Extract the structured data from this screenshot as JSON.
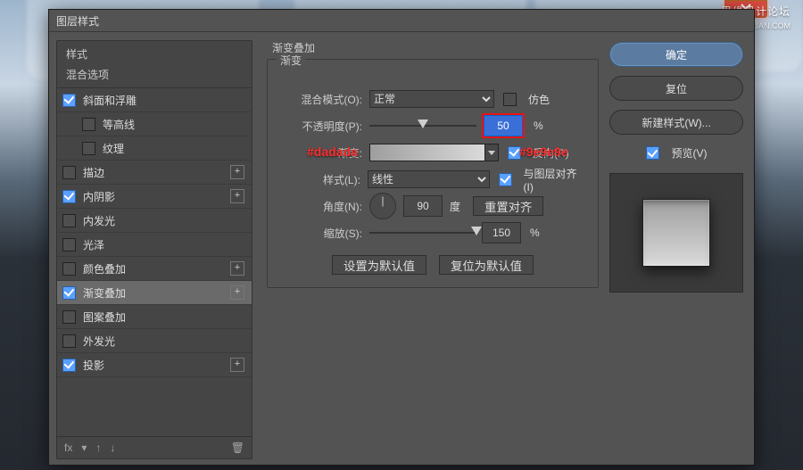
{
  "watermark": {
    "line1": "思缘设计论坛",
    "line2": "WWW.MISSYUAN.COM"
  },
  "dialog": {
    "title": "图层样式"
  },
  "styles_panel": {
    "header": "样式",
    "subheader": "混合选项",
    "items": [
      {
        "label": "斜面和浮雕",
        "checked": true,
        "plus": false,
        "indent": false,
        "selected": false
      },
      {
        "label": "等高线",
        "checked": false,
        "plus": false,
        "indent": true,
        "selected": false
      },
      {
        "label": "纹理",
        "checked": false,
        "plus": false,
        "indent": true,
        "selected": false
      },
      {
        "label": "描边",
        "checked": false,
        "plus": true,
        "indent": false,
        "selected": false
      },
      {
        "label": "内阴影",
        "checked": true,
        "plus": true,
        "indent": false,
        "selected": false
      },
      {
        "label": "内发光",
        "checked": false,
        "plus": false,
        "indent": false,
        "selected": false
      },
      {
        "label": "光泽",
        "checked": false,
        "plus": false,
        "indent": false,
        "selected": false
      },
      {
        "label": "颜色叠加",
        "checked": false,
        "plus": true,
        "indent": false,
        "selected": false
      },
      {
        "label": "渐变叠加",
        "checked": true,
        "plus": true,
        "indent": false,
        "selected": true
      },
      {
        "label": "图案叠加",
        "checked": false,
        "plus": false,
        "indent": false,
        "selected": false
      },
      {
        "label": "外发光",
        "checked": false,
        "plus": false,
        "indent": false,
        "selected": false
      },
      {
        "label": "投影",
        "checked": true,
        "plus": true,
        "indent": false,
        "selected": false
      }
    ],
    "footer": {
      "fx": "fx"
    }
  },
  "main": {
    "title": "渐变叠加",
    "group_label": "渐变",
    "labels": {
      "blend": "混合模式(O):",
      "opacity": "不透明度(P):",
      "gradient": "渐变:",
      "style": "样式(L):",
      "angle": "角度(N):",
      "scale": "缩放(S):",
      "deg": "度",
      "pct": "%"
    },
    "checks": {
      "dither": "仿色",
      "reverse": "反向(R)",
      "align": "与图层对齐(I)"
    },
    "values": {
      "blend_option": "正常",
      "opacity": "50",
      "style_option": "线性",
      "angle": "90",
      "scale": "150"
    },
    "buttons": {
      "reset_align": "重置对齐",
      "make_default": "设置为默认值",
      "reset_default": "复位为默认值"
    },
    "annotations": {
      "left": "#dadada",
      "right": "#9e9e9e"
    }
  },
  "right": {
    "ok": "确定",
    "cancel": "复位",
    "new_style": "新建样式(W)...",
    "preview": "预览(V)"
  }
}
